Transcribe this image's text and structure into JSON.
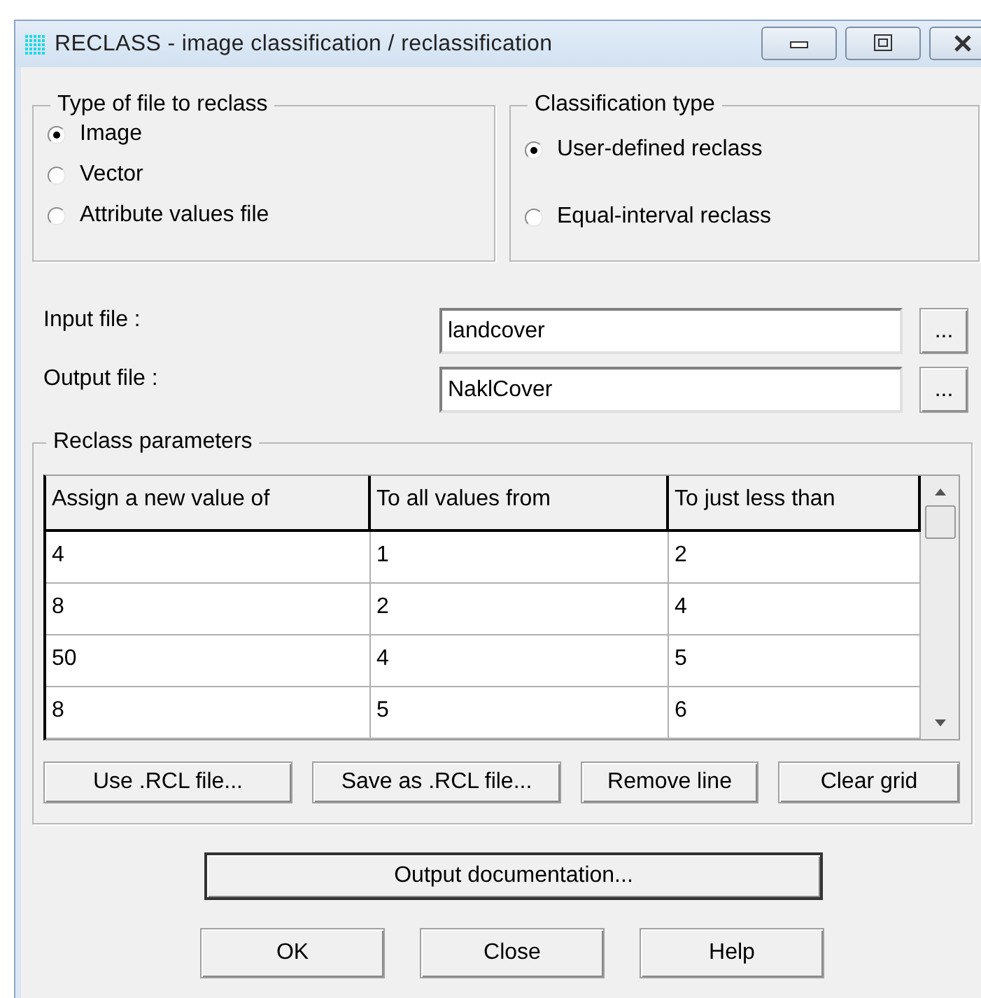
{
  "window": {
    "title": "RECLASS - image classification / reclassification"
  },
  "file_type": {
    "title": "Type of file to reclass",
    "options": [
      {
        "label": "Image",
        "selected": true
      },
      {
        "label": "Vector",
        "selected": false
      },
      {
        "label": "Attribute values file",
        "selected": false
      }
    ]
  },
  "classification_type": {
    "title": "Classification type",
    "options": [
      {
        "label": "User-defined reclass",
        "selected": true
      },
      {
        "label": "Equal-interval reclass",
        "selected": false
      }
    ]
  },
  "files": [
    {
      "label": "Input file :",
      "value": "landcover",
      "browse": "..."
    },
    {
      "label": "Output file :",
      "value": "NaklCover",
      "browse": "..."
    }
  ],
  "reclass_parameters": {
    "title": "Reclass parameters",
    "table": {
      "columns": [
        "Assign a new value of",
        "To all values from",
        "To just less than"
      ],
      "rows": [
        [
          "4",
          "1",
          "2"
        ],
        [
          "8",
          "2",
          "4"
        ],
        [
          "50",
          "4",
          "5"
        ],
        [
          "8",
          "5",
          "6"
        ]
      ]
    },
    "buttons": [
      "Use .RCL file...",
      "Save as .RCL file...",
      "Remove line",
      "Clear grid"
    ]
  },
  "output_documentation": {
    "label": "Output documentation...",
    "default": true
  },
  "buttons": [
    "OK",
    "Close",
    "Help"
  ]
}
